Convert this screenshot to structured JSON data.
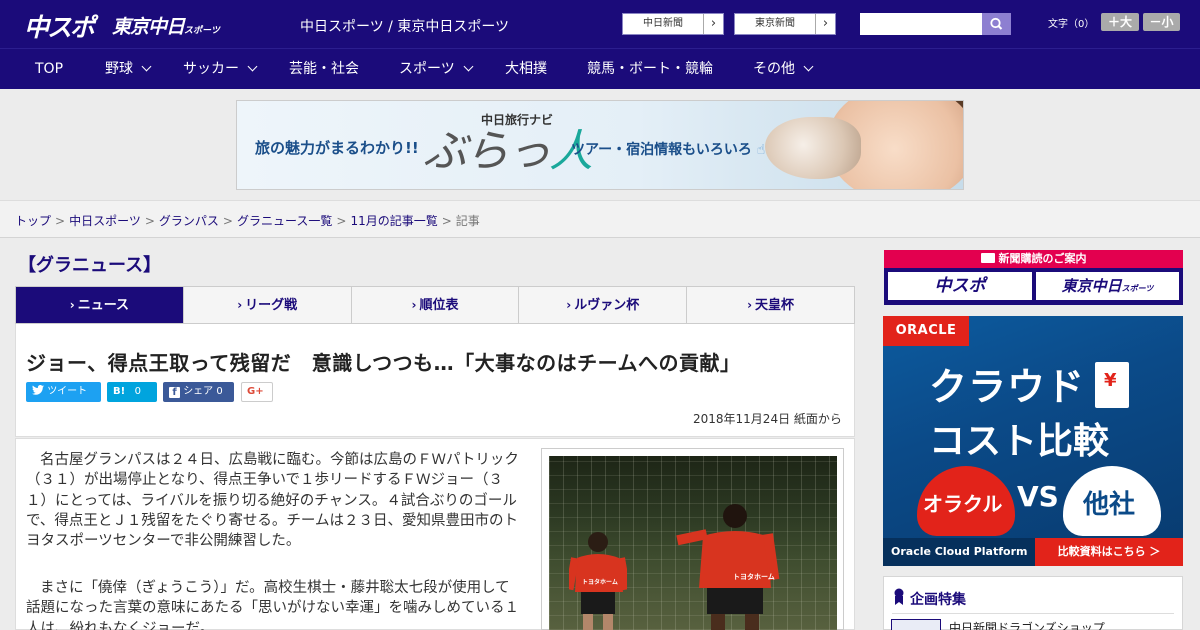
{
  "header": {
    "logo_chuspo": "中スポ",
    "logo_tokyo": "東京中日",
    "logo_tokyo_sub": "スポーツ",
    "site_title": "中日スポーツ / 東京中日スポーツ",
    "paper_links": [
      "中日新聞",
      "東京新聞"
    ],
    "search_placeholder": "",
    "font_size_label": "文字（0）",
    "font_larger": "＋大",
    "font_smaller": "－小"
  },
  "nav": {
    "items": [
      {
        "label": "TOP"
      },
      {
        "label": "野球"
      },
      {
        "label": "サッカー"
      },
      {
        "label": "芸能・社会"
      },
      {
        "label": "スポーツ"
      },
      {
        "label": "大相撲"
      },
      {
        "label": "競馬・ボート・競輪"
      },
      {
        "label": "その他"
      }
    ]
  },
  "banner": {
    "tagline": "旅の魅力がまるわかり!!",
    "brand_sub": "中日旅行ナビ",
    "brand_a": "ぶらっ",
    "brand_b": "人",
    "tagline2": "ツアー・宿泊情報もいろいろ"
  },
  "breadcrumb": [
    "トップ",
    "中日スポーツ",
    "グランパス",
    "グラニュース一覧",
    "11月の記事一覧",
    "記事"
  ],
  "section_title": "【グラニュース】",
  "tabs": [
    "ニュース",
    "リーグ戦",
    "順位表",
    "ルヴァン杯",
    "天皇杯"
  ],
  "article": {
    "headline": "ジョー、得点王取って残留だ　意識しつつも…「大事なのはチームへの貢献」",
    "date": "2018年11月24日 紙面から",
    "social": {
      "tweet": "ツイート",
      "hatena_count": "0",
      "share": "シェア",
      "share_count": "0"
    },
    "paragraphs": [
      "名古屋グランパスは２４日、広島戦に臨む。今節は広島のＦＷパトリック（３１）が出場停止となり、得点王争いで１歩リードするＦＷジョー（３１）にとっては、ライバルを振り切る絶好のチャンス。４試合ぶりのゴールで、得点王とＪ１残留をたぐり寄せる。チームは２３日、愛知県豊田市のトヨタスポーツセンターで非公開練習した。",
      "まさに「僥倖（ぎょうこう）」だ。高校生棋士・藤井聡太七段が使用して話題になった言葉の意味にあたる「思いがけない幸運」を噛みしめている１人は、紛れもなくジョーだ。"
    ],
    "photo_jersey": "トヨタホーム"
  },
  "sidebar": {
    "subscribe_title": "新聞購読のご案内",
    "subscribe_left": "中スポ",
    "subscribe_right": "東京中日",
    "subscribe_right_sub": "スポーツ",
    "ad": {
      "logo": "ORACLE",
      "headline1": "クラウド",
      "headline2": "コスト比較",
      "yen": "¥",
      "left": "オラクル",
      "vs": "VS",
      "right": "他社",
      "footer_left": "Oracle Cloud Platform",
      "footer_right": "比較資料はこちら ＞"
    },
    "feature_title": "企画特集",
    "feature_item": "中日新聞ドラゴンズショップ"
  },
  "colors": {
    "brand_navy": "#1b0b7a",
    "accent_red": "#e3004f",
    "twitter": "#1da1f2",
    "hatena": "#00a4de",
    "facebook": "#3b5998"
  }
}
